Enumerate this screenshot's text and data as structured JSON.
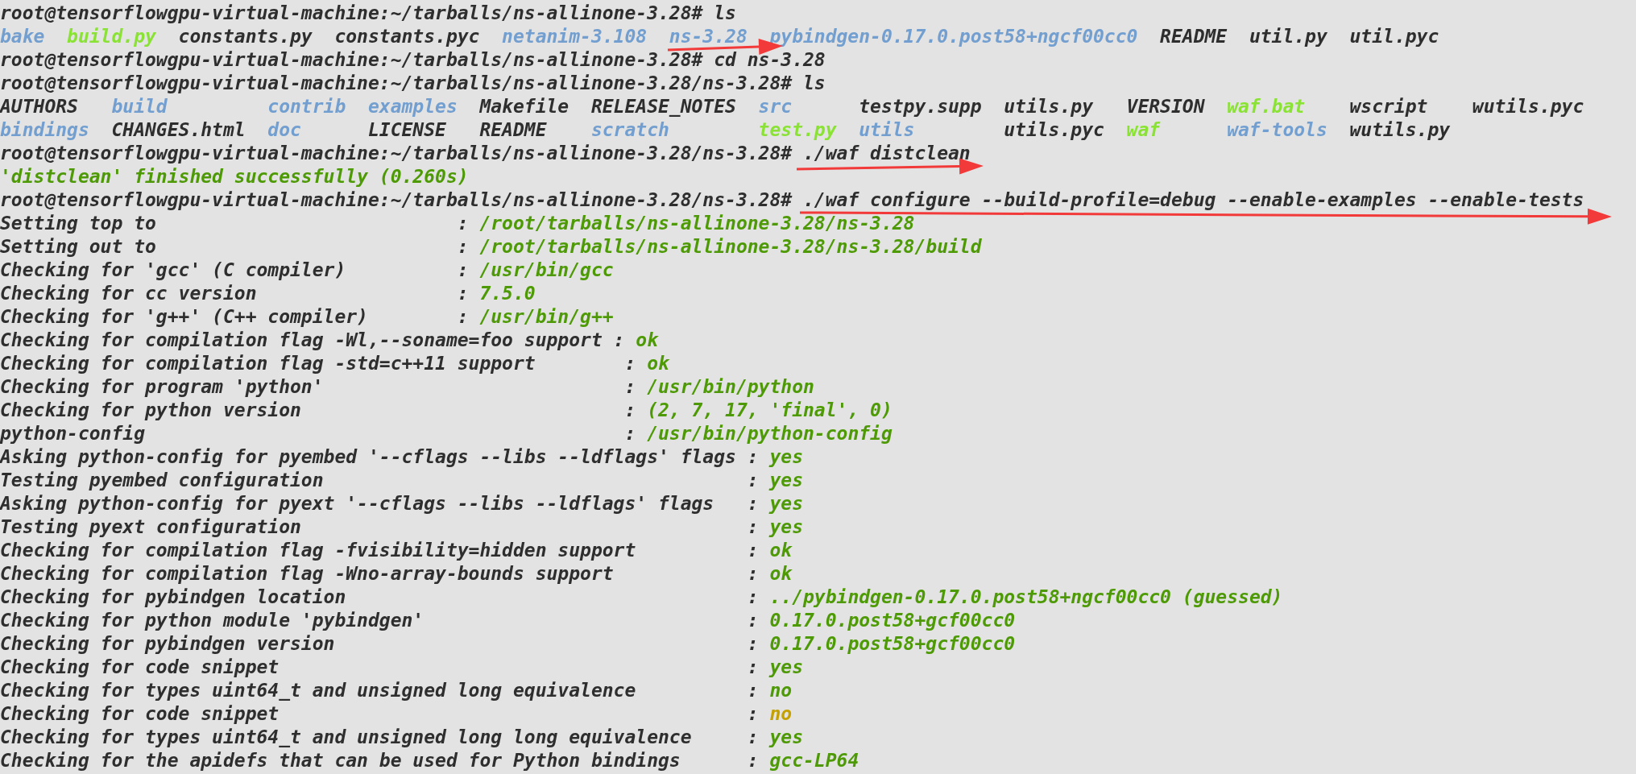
{
  "terminal": {
    "lines": [
      {
        "kind": "command",
        "text": "root@tensorflowgpu-virtual-machine:~/tarballs/ns-allinone-3.28# ls"
      },
      {
        "kind": "listing",
        "rows": [
          [
            {
              "name": "bake",
              "kind": "dir"
            },
            {
              "name": "build.py",
              "kind": "exec"
            },
            {
              "name": "constants.py",
              "kind": "file"
            },
            {
              "name": "constants.pyc",
              "kind": "file"
            },
            {
              "name": "netanim-3.108",
              "kind": "dir"
            },
            {
              "name": "ns-3.28",
              "kind": "dir"
            },
            {
              "name": "pybindgen-0.17.0.post58+ngcf00cc0",
              "kind": "dir"
            },
            {
              "name": "README",
              "kind": "file"
            },
            {
              "name": "util.py",
              "kind": "file"
            },
            {
              "name": "util.pyc",
              "kind": "file"
            }
          ]
        ]
      },
      {
        "kind": "command",
        "text": "root@tensorflowgpu-virtual-machine:~/tarballs/ns-allinone-3.28# cd ns-3.28"
      },
      {
        "kind": "command",
        "text": "root@tensorflowgpu-virtual-machine:~/tarballs/ns-allinone-3.28/ns-3.28# ls"
      },
      {
        "kind": "listing",
        "rows": [
          [
            {
              "name": "AUTHORS",
              "kind": "file"
            },
            {
              "name": "build",
              "kind": "dir"
            },
            {
              "name": "contrib",
              "kind": "dir"
            },
            {
              "name": "examples",
              "kind": "dir"
            },
            {
              "name": "Makefile",
              "kind": "file"
            },
            {
              "name": "RELEASE_NOTES",
              "kind": "file"
            },
            {
              "name": "src",
              "kind": "dir"
            },
            {
              "name": "testpy.supp",
              "kind": "file"
            },
            {
              "name": "utils.py",
              "kind": "file"
            },
            {
              "name": "VERSION",
              "kind": "file"
            },
            {
              "name": "waf.bat",
              "kind": "exec"
            },
            {
              "name": "wscript",
              "kind": "file"
            },
            {
              "name": "wutils.pyc",
              "kind": "file"
            }
          ],
          [
            {
              "name": "bindings",
              "kind": "dir"
            },
            {
              "name": "CHANGES.html",
              "kind": "file"
            },
            {
              "name": "doc",
              "kind": "dir"
            },
            {
              "name": "LICENSE",
              "kind": "file"
            },
            {
              "name": "README",
              "kind": "file"
            },
            {
              "name": "scratch",
              "kind": "dir"
            },
            {
              "name": "test.py",
              "kind": "exec"
            },
            {
              "name": "utils",
              "kind": "dir"
            },
            {
              "name": "utils.pyc",
              "kind": "file"
            },
            {
              "name": "waf",
              "kind": "exec"
            },
            {
              "name": "waf-tools",
              "kind": "dir"
            },
            {
              "name": "wutils.py",
              "kind": "file"
            }
          ]
        ]
      },
      {
        "kind": "command",
        "text": "root@tensorflowgpu-virtual-machine:~/tarballs/ns-allinone-3.28/ns-3.28# ./waf distclean"
      },
      {
        "kind": "success",
        "text": "'distclean' finished successfully (0.260s)"
      },
      {
        "kind": "command",
        "text": "root@tensorflowgpu-virtual-machine:~/tarballs/ns-allinone-3.28/ns-3.28# ./waf configure --build-profile=debug --enable-examples --enable-tests"
      },
      {
        "kind": "checks",
        "items": [
          {
            "label": "Setting top to",
            "separator": ":",
            "value": "/root/tarballs/ns-allinone-3.28/ns-3.28",
            "color": "#4e9a06"
          },
          {
            "label": "Setting out to",
            "separator": ":",
            "value": "/root/tarballs/ns-allinone-3.28/ns-3.28/build",
            "color": "#4e9a06"
          },
          {
            "label": "Checking for 'gcc' (C compiler)",
            "separator": ":",
            "value": "/usr/bin/gcc",
            "color": "#4e9a06"
          },
          {
            "label": "Checking for cc version",
            "separator": ":",
            "value": "7.5.0",
            "color": "#4e9a06"
          },
          {
            "label": "Checking for 'g++' (C++ compiler)",
            "separator": ":",
            "value": "/usr/bin/g++",
            "color": "#4e9a06"
          }
        ]
      },
      {
        "kind": "checks",
        "items": [
          {
            "label": "Checking for compilation flag -Wl,--soname=foo support",
            "separator": ":",
            "value": "ok",
            "color": "#4e9a06"
          }
        ]
      },
      {
        "kind": "checks",
        "items": [
          {
            "label": "Checking for compilation flag -std=c++11 support",
            "separator": ":",
            "value": "ok",
            "color": "#4e9a06"
          },
          {
            "label": "Checking for program 'python'",
            "separator": ":",
            "value": "/usr/bin/python",
            "color": "#4e9a06"
          },
          {
            "label": "Checking for python version",
            "separator": ":",
            "value": "(2, 7, 17, 'final', 0)",
            "color": "#4e9a06"
          },
          {
            "label": "python-config",
            "separator": ":",
            "value": "/usr/bin/python-config",
            "color": "#4e9a06"
          }
        ]
      },
      {
        "kind": "checks",
        "items": [
          {
            "label": "Asking python-config for pyembed '--cflags --libs --ldflags' flags",
            "separator": ":",
            "value": "yes",
            "color": "#4e9a06"
          },
          {
            "label": "Testing pyembed configuration",
            "separator": ":",
            "value": "yes",
            "color": "#4e9a06"
          },
          {
            "label": "Asking python-config for pyext '--cflags --libs --ldflags' flags",
            "separator": ":",
            "value": "yes",
            "color": "#4e9a06"
          },
          {
            "label": "Testing pyext configuration",
            "separator": ":",
            "value": "yes",
            "color": "#4e9a06"
          },
          {
            "label": "Checking for compilation flag -fvisibility=hidden support",
            "separator": ":",
            "value": "ok",
            "color": "#4e9a06"
          },
          {
            "label": "Checking for compilation flag -Wno-array-bounds support",
            "separator": ":",
            "value": "ok",
            "color": "#4e9a06"
          },
          {
            "label": "Checking for pybindgen location",
            "separator": ":",
            "value": "../pybindgen-0.17.0.post58+ngcf00cc0 (guessed)",
            "color": "#4e9a06"
          },
          {
            "label": "Checking for python module 'pybindgen'",
            "separator": ":",
            "value": "0.17.0.post58+gcf00cc0",
            "color": "#4e9a06"
          },
          {
            "label": "Checking for pybindgen version",
            "separator": ":",
            "value": "0.17.0.post58+gcf00cc0",
            "color": "#4e9a06"
          },
          {
            "label": "Checking for code snippet",
            "separator": ":",
            "value": "yes",
            "color": "#4e9a06"
          },
          {
            "label": "Checking for types uint64_t and unsigned long equivalence",
            "separator": ":",
            "value": "no",
            "color": "#4e9a06"
          },
          {
            "label": "Checking for code snippet",
            "separator": ":",
            "value": "no",
            "color": "#c4a000"
          },
          {
            "label": "Checking for types uint64_t and unsigned long long equivalence",
            "separator": ":",
            "value": "yes",
            "color": "#4e9a06"
          },
          {
            "label": "Checking for the apidefs that can be used for Python bindings",
            "separator": ":",
            "value": "gcc-LP64",
            "color": "#4e9a06"
          }
        ]
      }
    ]
  }
}
